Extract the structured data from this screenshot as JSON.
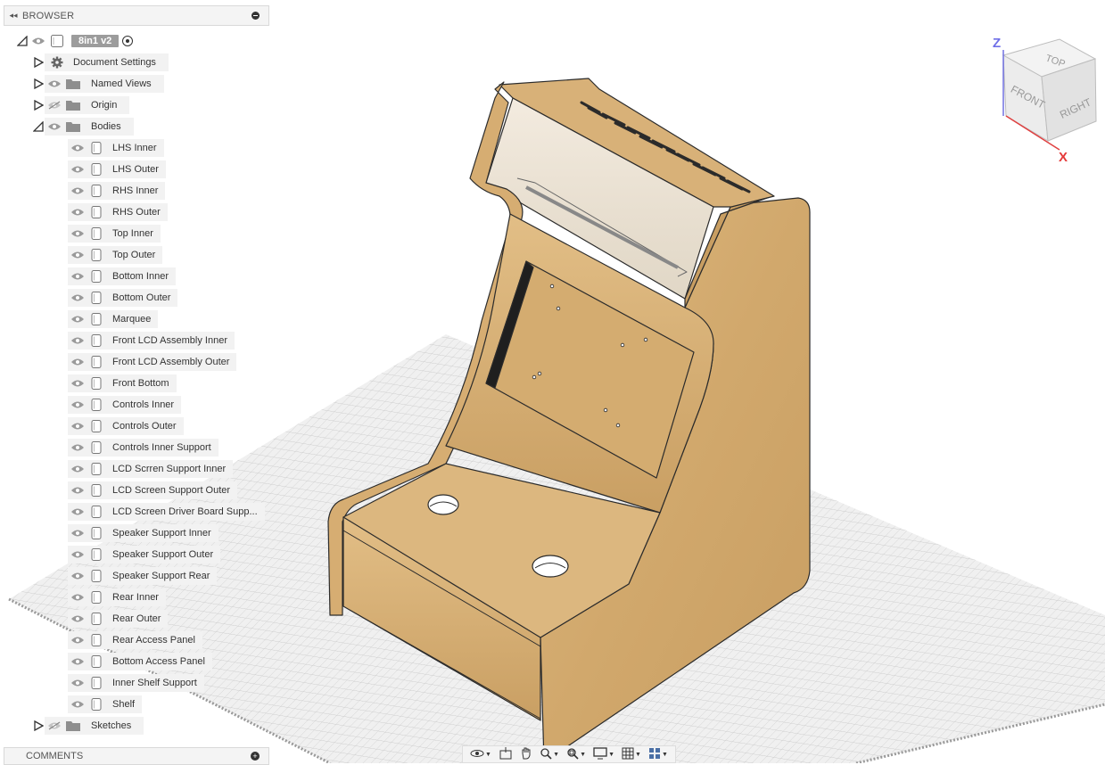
{
  "browser": {
    "title": "BROWSER",
    "root": {
      "name": "8in1 v2"
    },
    "top_items": [
      {
        "label": "Document Settings",
        "icon": "gear-icon"
      },
      {
        "label": "Named Views",
        "icon": "folder-icon"
      },
      {
        "label": "Origin",
        "icon": "folder-icon",
        "visible": false
      },
      {
        "label": "Bodies",
        "icon": "folder-icon",
        "expanded": true
      }
    ],
    "bodies": [
      "LHS Inner",
      "LHS Outer",
      "RHS Inner",
      "RHS Outer",
      "Top Inner",
      "Top Outer",
      "Bottom Inner",
      "Bottom Outer",
      "Marquee",
      "Front LCD Assembly  Inner",
      "Front LCD Assembly Outer",
      "Front Bottom",
      "Controls Inner",
      "Controls Outer",
      "Controls Inner Support",
      "LCD Scrren Support Inner",
      "LCD Screen Support Outer",
      "LCD Screen Driver Board Supp...",
      "Speaker Support Inner",
      "Speaker Support Outer",
      "Speaker Support Rear",
      "Rear Inner",
      "Rear Outer",
      "Rear Access Panel",
      "Bottom Access Panel",
      "Inner Shelf Support",
      "Shelf"
    ],
    "sketches": {
      "label": "Sketches",
      "visible": false
    }
  },
  "viewcube": {
    "faces": {
      "top": "TOP",
      "front": "FRONT",
      "right": "RIGHT"
    },
    "axes": {
      "z": "Z",
      "x": "X"
    },
    "colors": {
      "z": "#6f6fe8",
      "x": "#e53a3a"
    }
  },
  "comments": {
    "title": "COMMENTS"
  },
  "navigation_toolbar": {
    "tools": [
      "orbit-icon",
      "look-at-icon",
      "pan-icon",
      "zoom-icon",
      "fit-icon",
      "display-settings-icon",
      "grid-icon",
      "viewports-icon"
    ]
  },
  "colors": {
    "wood": "#d9b47a",
    "wood_dark": "#b08a52",
    "grid": "#c9c9c9"
  }
}
